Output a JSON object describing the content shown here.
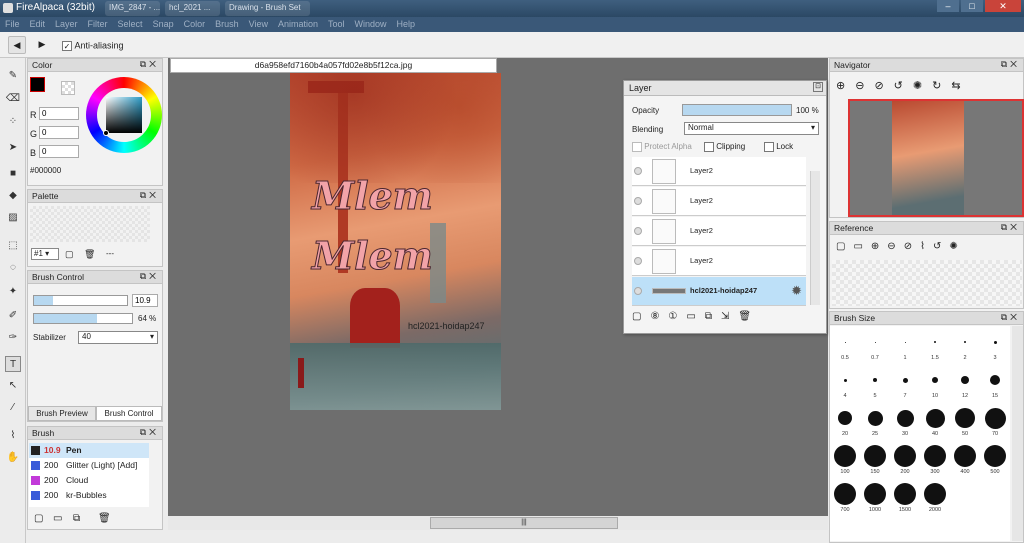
{
  "app": {
    "title": "FireAlpaca (32bit)",
    "tabs": [
      "IMG_2847 - ...",
      "hcl_2021 ...",
      "Drawing - Brush Set"
    ]
  },
  "window_buttons": {
    "minimize": "–",
    "maximize": "□",
    "close": "✕"
  },
  "menu": [
    "File",
    "Edit",
    "Layer",
    "Filter",
    "Select",
    "Snap",
    "Color",
    "Brush",
    "View",
    "Animation",
    "Tool",
    "Window",
    "Help"
  ],
  "toolbar": {
    "anti_aliasing_label": "Anti-aliasing",
    "anti_aliasing_checked": true
  },
  "color_panel": {
    "title": "Color",
    "r_label": "R",
    "g_label": "G",
    "b_label": "B",
    "r": "0",
    "g": "0",
    "b": "0",
    "hex": "#000000",
    "primary": "#000000"
  },
  "palette_panel": {
    "title": "Palette",
    "selector": "#1",
    "dashes": "---"
  },
  "brush_control": {
    "title": "Brush Control",
    "size": "10.9",
    "opacity": "64 %",
    "opacity_value": 0.64,
    "size_fill": 0.2,
    "stabilizer_label": "Stabilizer",
    "stabilizer_value": "40"
  },
  "brush_tabs": {
    "preview": "Brush Preview",
    "control": "Brush Control"
  },
  "brush_panel": {
    "title": "Brush",
    "items": [
      {
        "size": "10.9",
        "name": "Pen",
        "color": "#222222",
        "selected": true
      },
      {
        "size": "200",
        "name": "Glitter (Light) [Add]",
        "color": "#3a5bd9"
      },
      {
        "size": "200",
        "name": "Cloud",
        "color": "#c23ad9"
      },
      {
        "size": "200",
        "name": "kr-Bubbles",
        "color": "#3a5bd9"
      }
    ]
  },
  "document": {
    "filename": "d6a958efd7160b4a057fd02e8b5f12ca.jpg",
    "watermark": "hcl2021-hoidap247",
    "overlay_word_1": "Mlem",
    "overlay_word_2": "Mlem",
    "stamp_text": "..."
  },
  "layer_panel": {
    "title": "Layer",
    "opacity_label": "Opacity",
    "opacity_value": "100 %",
    "blending_label": "Blending",
    "blending_value": "Normal",
    "protect_alpha": "Protect Alpha",
    "clipping": "Clipping",
    "lock": "Lock",
    "layers": [
      {
        "name": "Layer2",
        "selected": false
      },
      {
        "name": "Layer2",
        "selected": false
      },
      {
        "name": "Layer2",
        "selected": false
      },
      {
        "name": "Layer2",
        "selected": false
      },
      {
        "name": "hcl2021-hoidap247",
        "selected": true
      }
    ]
  },
  "navigator": {
    "title": "Navigator"
  },
  "reference": {
    "title": "Reference"
  },
  "brush_size": {
    "title": "Brush Size",
    "sizes": [
      "0.5",
      "0.7",
      "1",
      "1.5",
      "2",
      "3",
      "4",
      "5",
      "7",
      "10",
      "12",
      "15",
      "20",
      "25",
      "30",
      "40",
      "50",
      "70",
      "100",
      "150",
      "200",
      "300",
      "400",
      "500",
      "700",
      "1000",
      "1500",
      "2000"
    ]
  },
  "scrollbar": {
    "grip": "|||"
  }
}
